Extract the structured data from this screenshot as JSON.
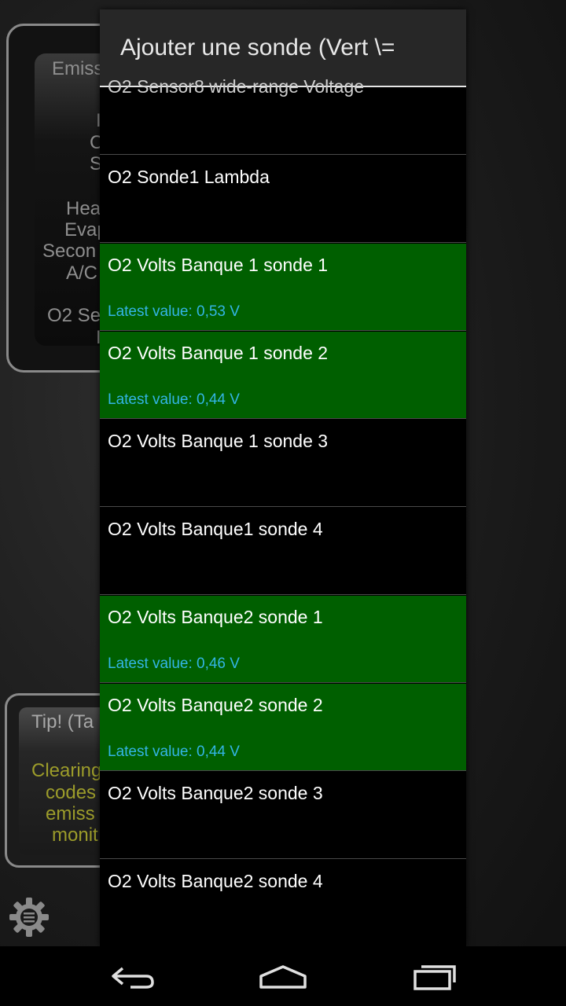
{
  "background": {
    "emission_panel": {
      "title_fragment": "Emiss",
      "lines": [
        "I",
        "C",
        "S",
        "",
        "Hea",
        "Evap",
        "Secon",
        "A/C",
        "",
        "O2 Se",
        "I"
      ]
    },
    "tip_panel": {
      "title_fragment": "Tip! (Ta",
      "lines": [
        "Clearing",
        "codes",
        "emiss",
        "monit"
      ]
    }
  },
  "dialog": {
    "title": "Ajouter une sonde (Vert  \\=",
    "partial_item": "O2 Sensor8 wide-range Voltage",
    "items": [
      {
        "label": "O2 Sonde1 Lambda",
        "selected": false,
        "value": ""
      },
      {
        "label": "O2 Volts Banque 1 sonde 1",
        "selected": true,
        "value": "Latest value: 0,53 V"
      },
      {
        "label": "O2 Volts Banque 1 sonde 2",
        "selected": true,
        "value": "Latest value: 0,44 V"
      },
      {
        "label": "O2 Volts Banque 1 sonde 3",
        "selected": false,
        "value": ""
      },
      {
        "label": "O2 Volts Banque1 sonde 4",
        "selected": false,
        "value": ""
      },
      {
        "label": "O2 Volts Banque2 sonde 1",
        "selected": true,
        "value": "Latest value: 0,46 V"
      },
      {
        "label": "O2 Volts Banque2 sonde 2",
        "selected": true,
        "value": "Latest value: 0,44 V"
      },
      {
        "label": "O2 Volts Banque2 sonde 3",
        "selected": false,
        "value": ""
      },
      {
        "label": "O2 Volts Banque2 sonde 4",
        "selected": false,
        "value": ""
      }
    ]
  },
  "colors": {
    "selected_bg": "#005f00",
    "value_text": "#33b5e5",
    "tip_text": "#9c9c2a"
  },
  "icons": {
    "settings": "gear-icon",
    "back": "back-icon",
    "home": "home-icon",
    "recents": "recent-apps-icon"
  }
}
